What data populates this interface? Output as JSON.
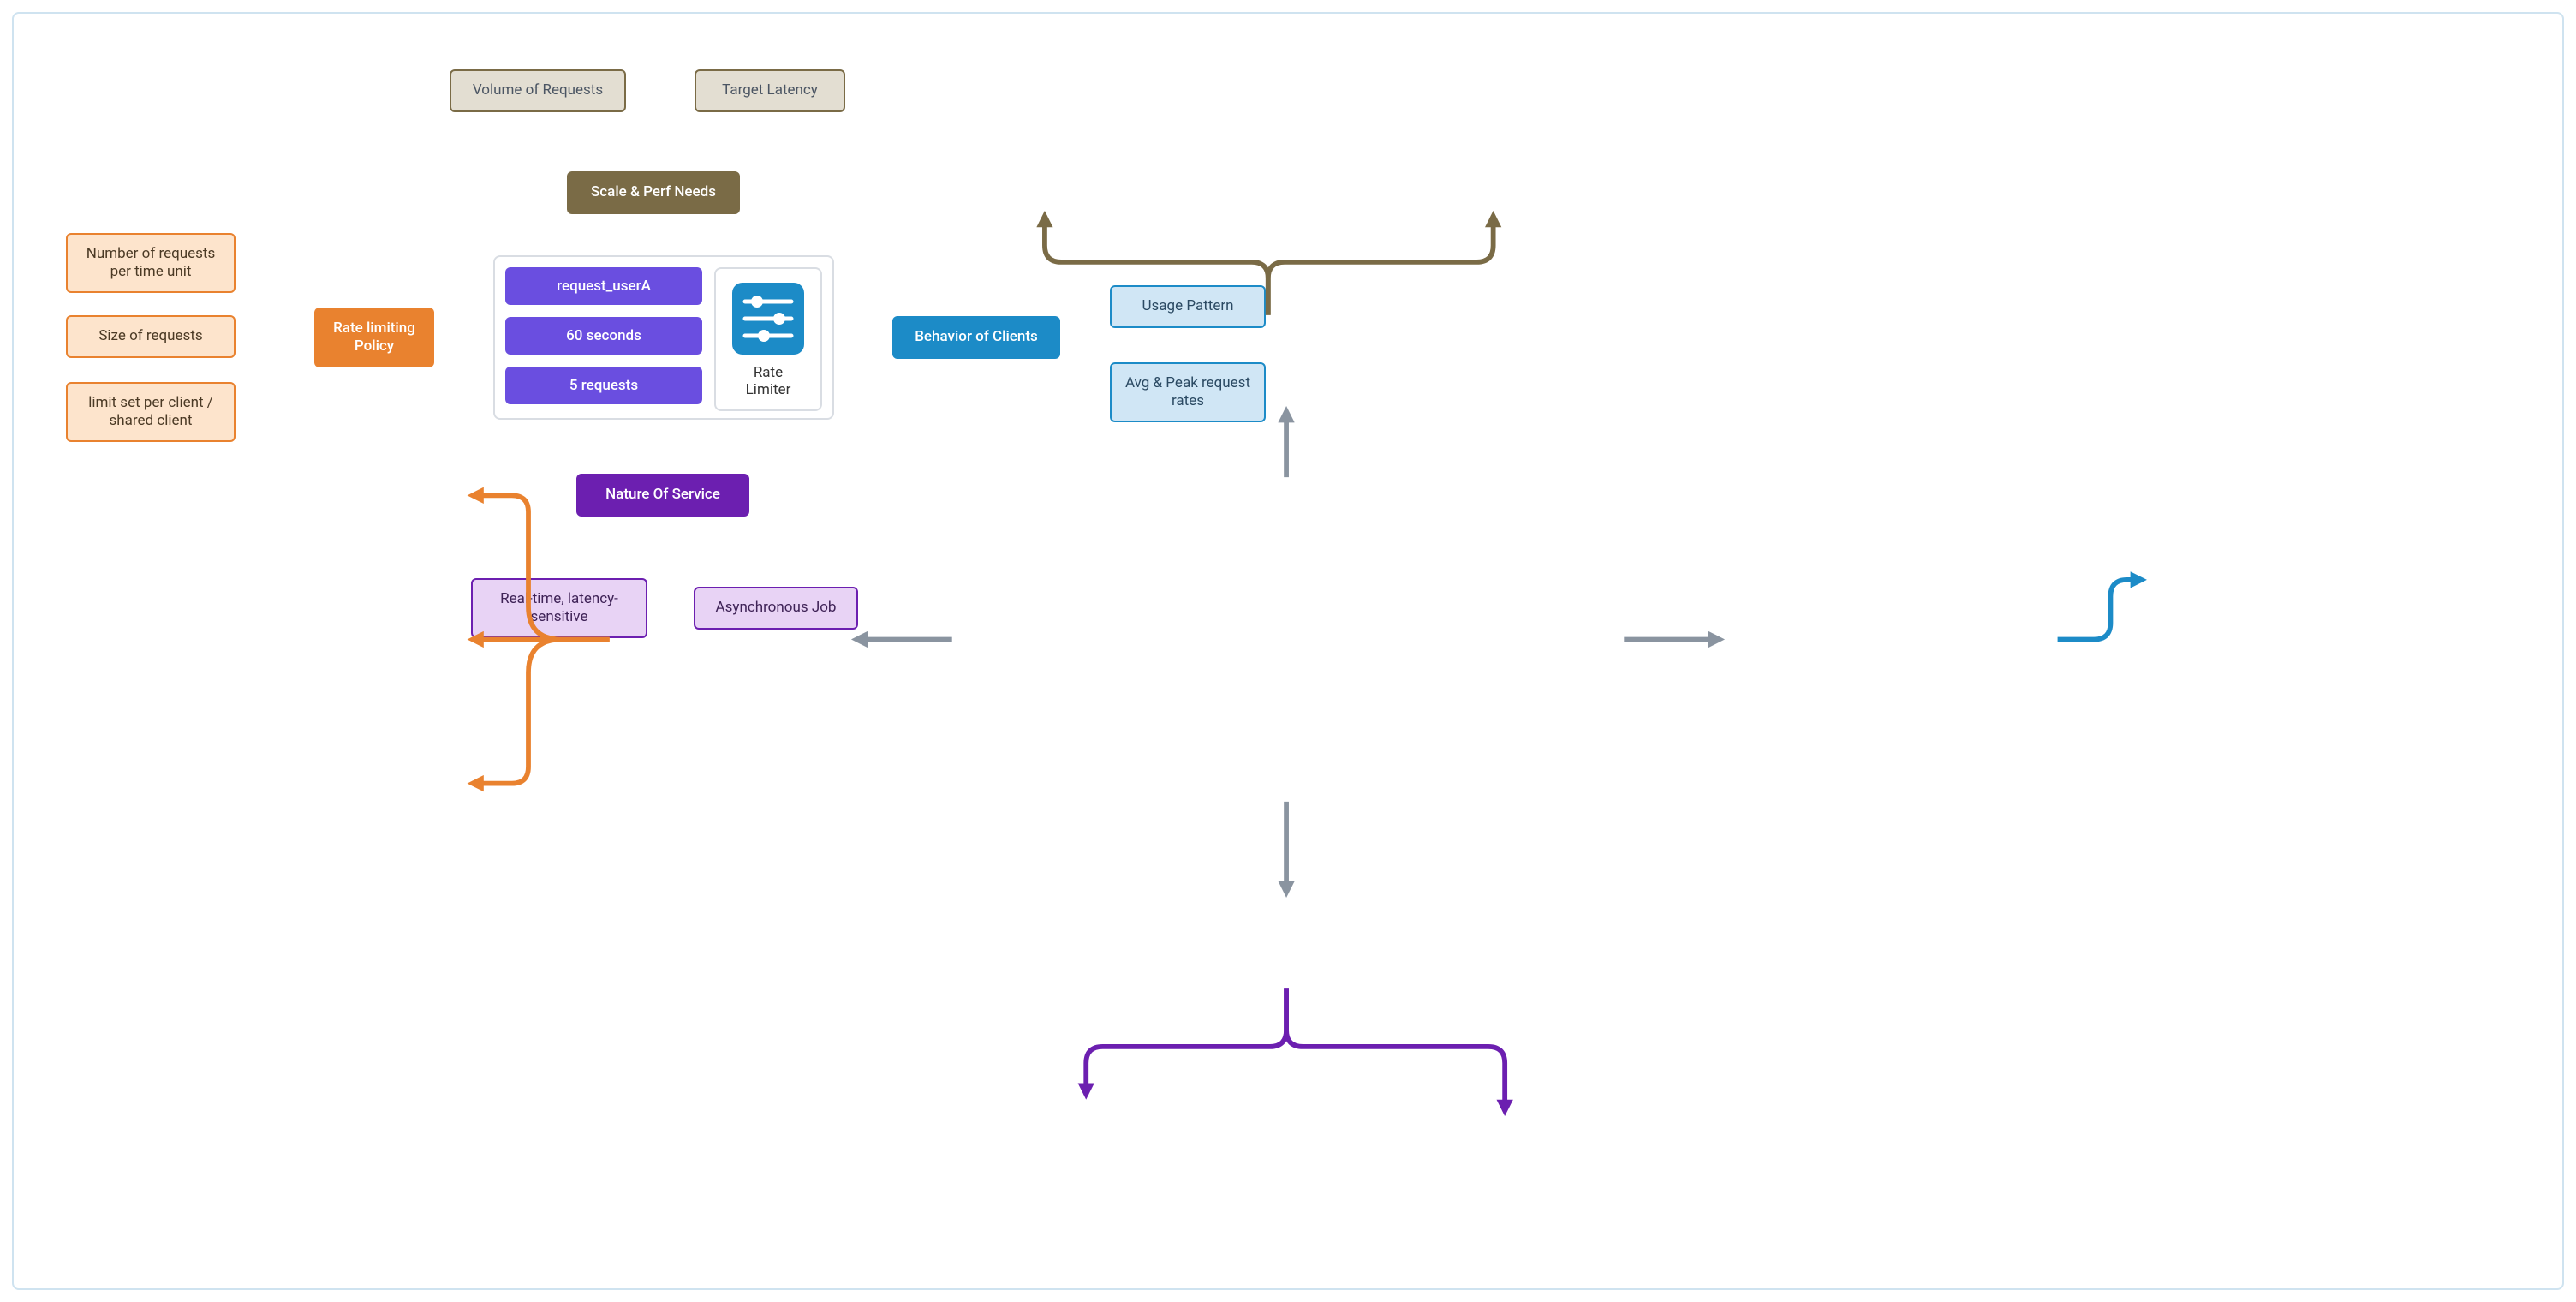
{
  "top": {
    "left_label": "Volume of Requests",
    "right_label": "Target Latency",
    "hub_label": "Scale & Perf Needs"
  },
  "center": {
    "chip1": "request_userA",
    "chip2": "60 seconds",
    "chip3": "5 requests",
    "rate_limiter_line1": "Rate",
    "rate_limiter_line2": "Limiter"
  },
  "left": {
    "hub_label": "Rate limiting Policy",
    "item1": "Number of requests per time unit",
    "item2": "Size of requests",
    "item3": "limit set per client / shared client"
  },
  "right": {
    "hub_label": "Behavior of Clients",
    "item1": "Usage Pattern",
    "item2": "Avg & Peak request rates"
  },
  "bottom": {
    "hub_label": "Nature Of Service",
    "item1": "Real-time, latency-sensitive",
    "item2": "Asynchronous Job"
  },
  "colors": {
    "olive_dark": "#7a6b46",
    "olive_light": "#e3ded2",
    "olive_text": "#4b5563",
    "orange": "#e9822f",
    "orange_light": "#fde4cc",
    "blue": "#1c8bc7",
    "blue_light": "#d0e6f5",
    "purple_dark": "#6c1fb0",
    "purple_light": "#e8d3f5",
    "purple_chip": "#6a4ee0",
    "grey_arrow": "#8a94a0"
  }
}
